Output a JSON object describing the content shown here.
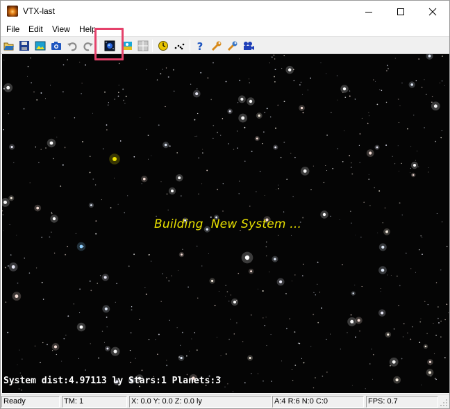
{
  "window": {
    "title": "VTX-last"
  },
  "menu": [
    "File",
    "Edit",
    "View",
    "Help"
  ],
  "toolbar": {
    "buttons": [
      {
        "name": "open-icon",
        "color": "#2a6fb8"
      },
      {
        "name": "save-icon",
        "color": "#1f3f8f"
      },
      {
        "name": "image-icon",
        "color": "#1aa0d0"
      },
      {
        "name": "camera-icon",
        "color": "#1f56c0"
      },
      {
        "name": "undo-icon",
        "color": "#8a8a8a"
      },
      {
        "name": "redo-icon",
        "color": "#8a8a8a"
      },
      {
        "name": "new-system-icon",
        "color": "#0a1a3a"
      },
      {
        "name": "galaxy-icon",
        "color": "#19a8d8"
      },
      {
        "name": "grid-icon",
        "color": "#9a9a9a"
      },
      {
        "name": "clock-icon",
        "color": "#e8c400"
      },
      {
        "name": "path-icon",
        "color": "#000000"
      },
      {
        "name": "help-icon",
        "color": "#1f56c0"
      },
      {
        "name": "wrench-icon",
        "color": "#d88a1c"
      },
      {
        "name": "wrench-blue-icon",
        "color": "#3a78c8"
      },
      {
        "name": "video-camera-icon",
        "color": "#1f3fb8"
      }
    ]
  },
  "viewport": {
    "message": "Building  New System ...",
    "message_color": "#e8e000",
    "system_info": "System dist:4.97113 ly Stars:1 Planets:3"
  },
  "status": {
    "ready": "Ready",
    "tm": "TM: 1",
    "coords": "X: 0.0 Y: 0.0 Z: 0.0 ly",
    "counts": "A:4  R:6  N:0  C:0",
    "fps": "FPS: 0.7"
  },
  "colors": {
    "highlight": "#e5426b",
    "sky": "#050505"
  }
}
